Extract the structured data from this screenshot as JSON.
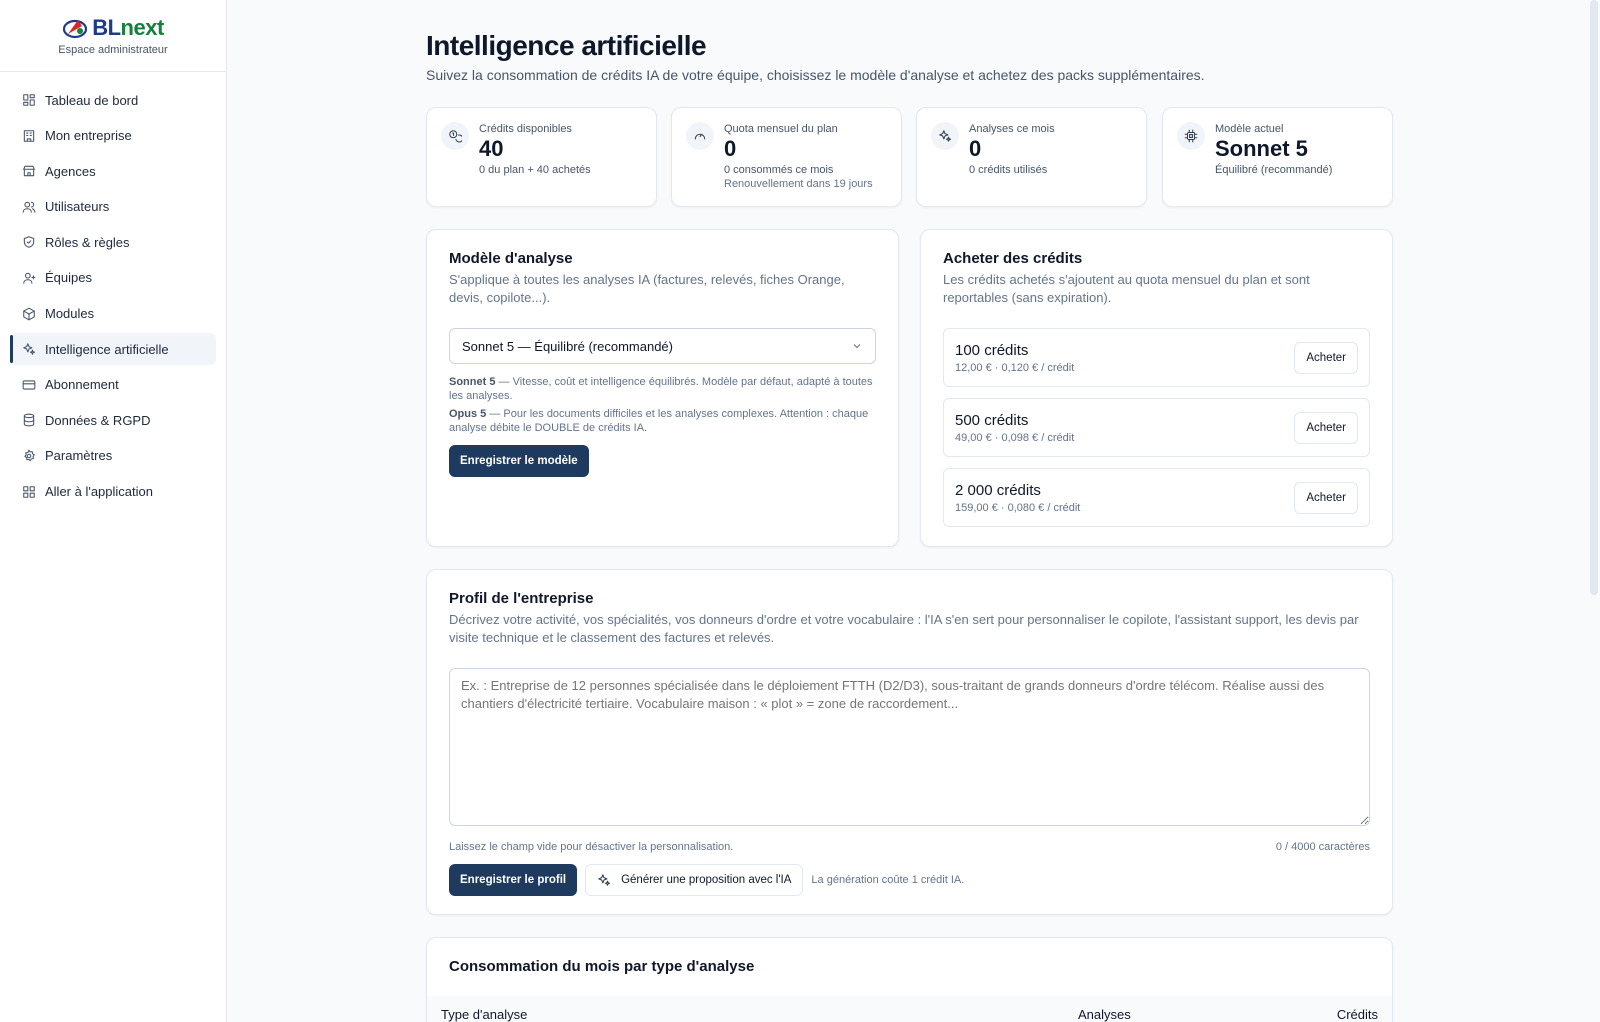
{
  "brand": {
    "name_part1": "BL",
    "name_part2": "next",
    "subtitle": "Espace administrateur"
  },
  "sidebar": {
    "items": [
      {
        "label": "Tableau de bord",
        "icon": "dashboard-icon"
      },
      {
        "label": "Mon entreprise",
        "icon": "building-icon"
      },
      {
        "label": "Agences",
        "icon": "store-icon"
      },
      {
        "label": "Utilisateurs",
        "icon": "users-icon"
      },
      {
        "label": "Rôles & règles",
        "icon": "shield-icon"
      },
      {
        "label": "Équipes",
        "icon": "team-icon"
      },
      {
        "label": "Modules",
        "icon": "package-icon"
      },
      {
        "label": "Intelligence artificielle",
        "icon": "sparkles-icon",
        "active": true
      },
      {
        "label": "Abonnement",
        "icon": "credit-card-icon"
      },
      {
        "label": "Données & RGPD",
        "icon": "database-icon"
      },
      {
        "label": "Paramètres",
        "icon": "gear-icon"
      },
      {
        "label": "Aller à l'application",
        "icon": "grid-icon"
      }
    ]
  },
  "page": {
    "title": "Intelligence artificielle",
    "subtitle": "Suivez la consommation de crédits IA de votre équipe, choisissez le modèle d'analyse et achetez des packs supplémentaires."
  },
  "stats": [
    {
      "label": "Crédits disponibles",
      "value": "40",
      "note": "0 du plan + 40 achetés",
      "note2": "",
      "icon": "coins-icon"
    },
    {
      "label": "Quota mensuel du plan",
      "value": "0",
      "note": "0 consommés ce mois",
      "note2": "Renouvellement dans 19 jours",
      "icon": "gauge-icon"
    },
    {
      "label": "Analyses ce mois",
      "value": "0",
      "note": "0 crédits utilisés",
      "note2": "",
      "icon": "sparkles-icon"
    },
    {
      "label": "Modèle actuel",
      "value": "Sonnet 5",
      "note": "Équilibré (recommandé)",
      "note2": "",
      "icon": "cpu-icon"
    }
  ],
  "model": {
    "title": "Modèle d'analyse",
    "desc": "S'applique à toutes les analyses IA (factures, relevés, fiches Orange, devis, copilote...).",
    "selected": "Sonnet 5 — Équilibré (recommandé)",
    "note1_name": "Sonnet 5",
    "note1_text": " — Vitesse, coût et intelligence équilibrés. Modèle par défaut, adapté à toutes les analyses.",
    "note2_name": "Opus 5",
    "note2_text": " — Pour les documents difficiles et les analyses complexes. Attention : chaque analyse débite le DOUBLE de crédits IA.",
    "save_label": "Enregistrer le modèle"
  },
  "buy": {
    "title": "Acheter des crédits",
    "desc": "Les crédits achetés s'ajoutent au quota mensuel du plan et sont reportables (sans expiration).",
    "packs": [
      {
        "name": "100 crédits",
        "price": "12,00 € · 0,120 € / crédit"
      },
      {
        "name": "500 crédits",
        "price": "49,00 € · 0,098 € / crédit"
      },
      {
        "name": "2 000 crédits",
        "price": "159,00 € · 0,080 € / crédit"
      }
    ],
    "buy_label": "Acheter"
  },
  "profile": {
    "title": "Profil de l'entreprise",
    "desc": "Décrivez votre activité, vos spécialités, vos donneurs d'ordre et votre vocabulaire : l'IA s'en sert pour personnaliser le copilote, l'assistant support, les devis par visite technique et le classement des factures et relevés.",
    "placeholder": "Ex. : Entreprise de 12 personnes spécialisée dans le déploiement FTTH (D2/D3), sous-traitant de grands donneurs d'ordre télécom. Réalise aussi des chantiers d'électricité tertiaire. Vocabulaire maison : « plot » = zone de raccordement...",
    "hint": "Laissez le champ vide pour désactiver la personnalisation.",
    "counter": "0 / 4000 caractères",
    "save_label": "Enregistrer le profil",
    "ai_label": "Générer une proposition avec l'IA",
    "gen_note": "La génération coûte 1 crédit IA."
  },
  "usage": {
    "title": "Consommation du mois par type d'analyse",
    "col_type": "Type d'analyse",
    "col_analyses": "Analyses",
    "col_credits": "Crédits"
  },
  "colors": {
    "primary": "#1e3a5f",
    "brand_blue": "#1e3a8a",
    "brand_green": "#15803d"
  }
}
